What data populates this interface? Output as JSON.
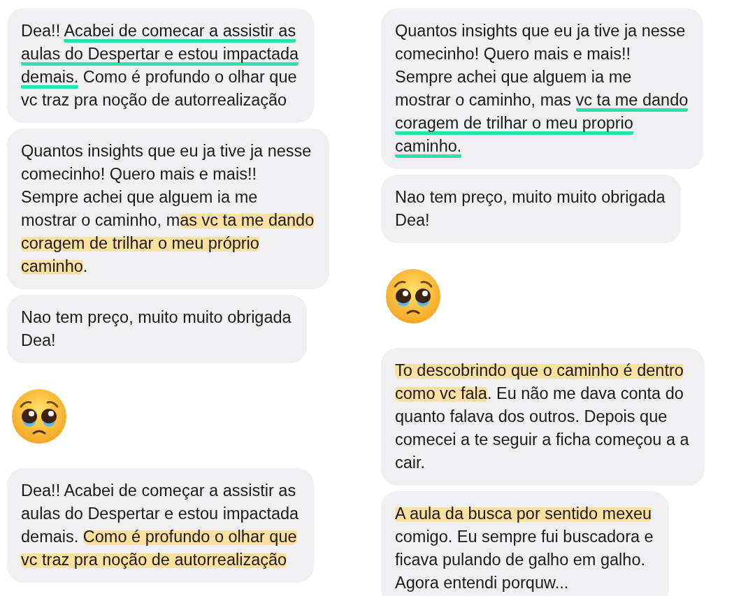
{
  "columns": [
    {
      "items": [
        {
          "kind": "message",
          "lines": [
            [
              {
                "text": "Dea!! ",
                "kind": "plain"
              },
              {
                "text": "Acabei de comecar a assistir as",
                "kind": "underline"
              }
            ],
            [
              {
                "text": "aulas do Despertar e estou impactada",
                "kind": "underline"
              }
            ],
            [
              {
                "text": "demais.",
                "kind": "underline"
              },
              {
                "text": " Como é profundo o olhar que",
                "kind": "plain"
              }
            ],
            [
              {
                "text": "vc traz pra noção de autorrealização",
                "kind": "plain"
              }
            ]
          ]
        },
        {
          "kind": "message",
          "lines": [
            [
              {
                "text": "Quantos insights que eu ja tive ja nesse",
                "kind": "plain"
              }
            ],
            [
              {
                "text": "comecinho! Quero mais e mais!!",
                "kind": "plain"
              }
            ],
            [
              {
                "text": "Sempre achei que alguem ia me",
                "kind": "plain"
              }
            ],
            [
              {
                "text": "mostrar o caminho, m",
                "kind": "plain"
              },
              {
                "text": "as vc ta me dando",
                "kind": "highlight"
              }
            ],
            [
              {
                "text": "coragem de trilhar o meu próprio",
                "kind": "highlight"
              }
            ],
            [
              {
                "text": "caminho",
                "kind": "highlight"
              },
              {
                "text": ".",
                "kind": "plain"
              }
            ]
          ]
        },
        {
          "kind": "message",
          "lines": [
            [
              {
                "text": "Nao tem preço, muito muito obrigada",
                "kind": "plain"
              }
            ],
            [
              {
                "text": "Dea!",
                "kind": "plain"
              }
            ]
          ]
        },
        {
          "kind": "emoji"
        },
        {
          "kind": "message",
          "lines": [
            [
              {
                "text": "Dea!! Acabei de começar a assistir as",
                "kind": "plain"
              }
            ],
            [
              {
                "text": "aulas do Despertar e estou impactada",
                "kind": "plain"
              }
            ],
            [
              {
                "text": "demais. ",
                "kind": "plain"
              },
              {
                "text": "Como é profundo o olhar que",
                "kind": "highlight"
              }
            ],
            [
              {
                "text": "vc traz pra noção de autorrealização",
                "kind": "highlight"
              }
            ]
          ]
        }
      ]
    },
    {
      "items": [
        {
          "kind": "message",
          "lines": [
            [
              {
                "text": "Quantos insights que eu ja tive ja nesse",
                "kind": "plain"
              }
            ],
            [
              {
                "text": "comecinho! Quero mais e mais!!",
                "kind": "plain"
              }
            ],
            [
              {
                "text": "Sempre achei que alguem ia me",
                "kind": "plain"
              }
            ],
            [
              {
                "text": "mostrar o caminho, mas ",
                "kind": "plain"
              },
              {
                "text": "vc ta me dando",
                "kind": "underline"
              }
            ],
            [
              {
                "text": "coragem de trilhar o meu proprio",
                "kind": "underline"
              }
            ],
            [
              {
                "text": "caminho.",
                "kind": "underline"
              }
            ]
          ]
        },
        {
          "kind": "message",
          "lines": [
            [
              {
                "text": "Nao tem preço, muito muito obrigada",
                "kind": "plain"
              }
            ],
            [
              {
                "text": "Dea!",
                "kind": "plain"
              }
            ]
          ]
        },
        {
          "kind": "emoji"
        },
        {
          "kind": "message",
          "lines": [
            [
              {
                "text": "To descobrindo que o caminho é dentro",
                "kind": "highlight"
              }
            ],
            [
              {
                "text": "como vc fala",
                "kind": "highlight"
              },
              {
                "text": ". Eu não me dava conta do",
                "kind": "plain"
              }
            ],
            [
              {
                "text": "quanto falava dos outros. Depois que",
                "kind": "plain"
              }
            ],
            [
              {
                "text": "comecei a te seguir a ficha começou a a",
                "kind": "plain"
              }
            ],
            [
              {
                "text": "cair.",
                "kind": "plain"
              }
            ]
          ]
        },
        {
          "kind": "message",
          "lines": [
            [
              {
                "text": "A aula da busca por sentido mexeu",
                "kind": "highlight"
              }
            ],
            [
              {
                "text": "comigo. Eu sempre fui buscadora e",
                "kind": "plain"
              }
            ],
            [
              {
                "text": "ficava pulando de galho em galho.",
                "kind": "plain"
              }
            ],
            [
              {
                "text": "Agora entendi porquw...",
                "kind": "plain"
              }
            ]
          ]
        }
      ]
    }
  ]
}
